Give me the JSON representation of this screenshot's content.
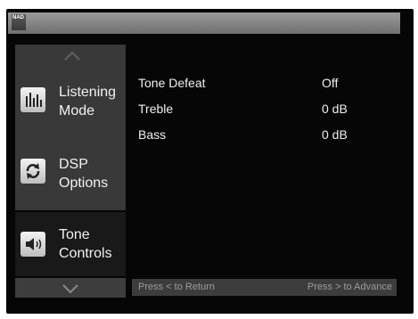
{
  "header": {
    "logo_text": "NAD"
  },
  "menu": {
    "items": [
      {
        "line1": "Listening",
        "line2": "Mode",
        "icon": "equalizer-icon"
      },
      {
        "line1": "DSP",
        "line2": "Options",
        "icon": "refresh-icon"
      },
      {
        "line1": "Tone",
        "line2": "Controls",
        "icon": "speaker-icon"
      }
    ],
    "selected": "Tone Controls"
  },
  "settings": [
    {
      "name": "Tone Defeat",
      "value": "Off"
    },
    {
      "name": "Treble",
      "value": "0 dB"
    },
    {
      "name": "Bass",
      "value": "0 dB"
    }
  ],
  "footer": {
    "return_hint": "Press < to Return",
    "advance_hint": "Press > to Advance"
  }
}
